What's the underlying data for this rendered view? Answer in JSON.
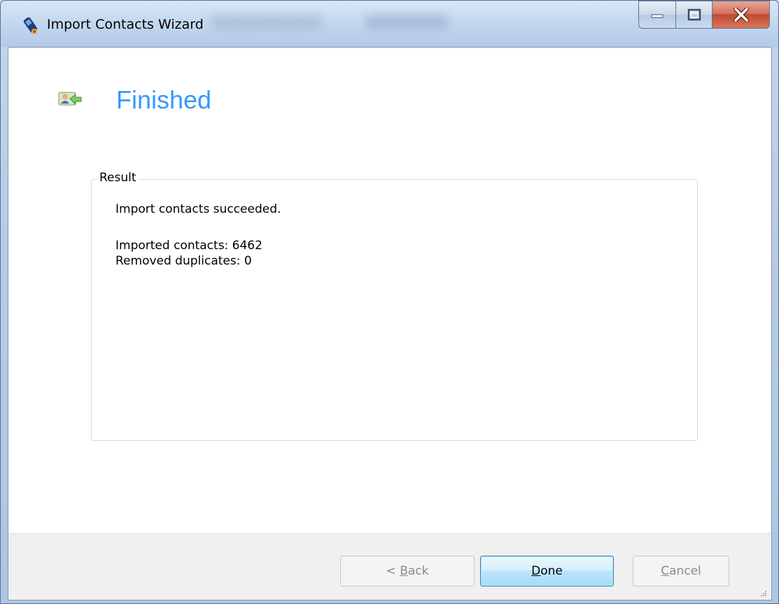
{
  "window": {
    "title": "Import Contacts Wizard"
  },
  "page": {
    "heading": "Finished"
  },
  "result": {
    "legend": "Result",
    "status": "Import contacts succeeded.",
    "imported": "Imported contacts: 6462",
    "removed": "Removed duplicates: 0"
  },
  "buttons": {
    "back": {
      "prefix": "< ",
      "mnemonic": "B",
      "rest": "ack",
      "enabled": false
    },
    "done": {
      "mnemonic": "D",
      "rest": "one",
      "enabled": true
    },
    "cancel": {
      "mnemonic": "C",
      "rest": "ancel",
      "enabled": false
    }
  },
  "icons": {
    "app": "phone-icon",
    "header": "import-contacts-icon",
    "minimize": "minimize-icon",
    "maximize": "maximize-icon",
    "close": "close-icon",
    "grip": "resize-grip-icon"
  },
  "colors": {
    "heading": "#3399ff",
    "close": "#c24a32",
    "default_button": "#3c7fb1"
  }
}
